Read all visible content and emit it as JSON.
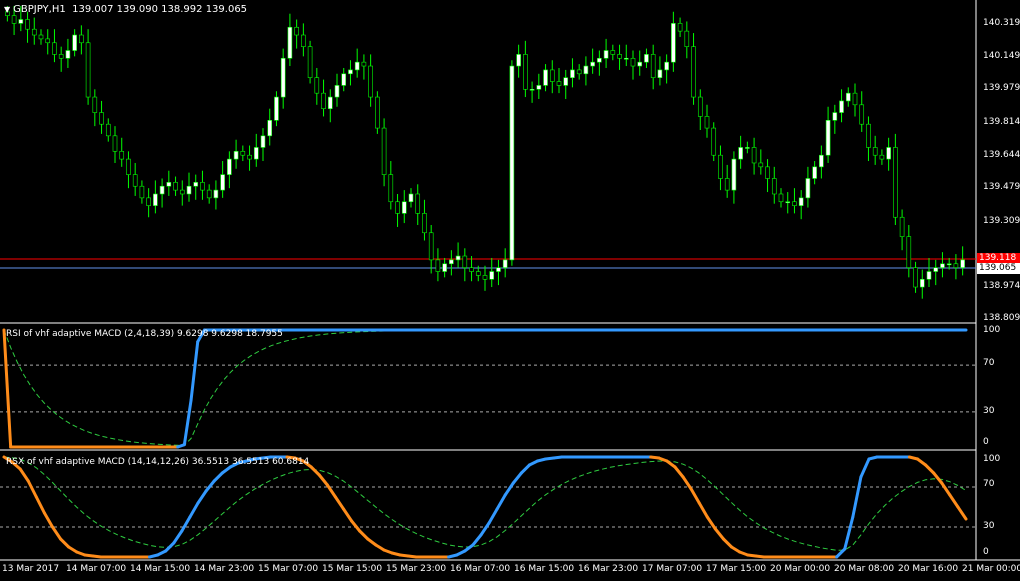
{
  "header": {
    "arrow_icon": "triangle-down-icon",
    "symbol": "GBPJPY,H1",
    "ohlc": "139.007 139.090 138.992 139.065"
  },
  "main_ticks": [
    "140.319",
    "140.149",
    "139.979",
    "139.814",
    "139.644",
    "139.479",
    "139.309",
    "138.974",
    "138.809"
  ],
  "current_price": "139.065",
  "red_level_price": "139.118",
  "colors": {
    "background": "#000000",
    "candle_up": "#ffffff",
    "candle_down": "#000000",
    "wick": "#00ff00",
    "red_line": "#ff0000",
    "blue_line": "#6495ed",
    "ind_up": "#3399ff",
    "ind_down": "#ff8c1a",
    "ind_signal": "#2ecc40"
  },
  "panel1": {
    "title": "RSI of vhf adaptive MACD (2,4,18,39) 9.6298 9.6298 18.7955",
    "ticks": [
      "100",
      "70",
      "30",
      "0"
    ]
  },
  "panel2": {
    "title": "RSX of vhf adaptive MACD (14,14,12,26) 36.5513 36.5513 60.6814",
    "ticks": [
      "100",
      "70",
      "30",
      "0"
    ]
  },
  "x_ticks": [
    "13 Mar 2017",
    "14 Mar 07:00",
    "14 Mar 15:00",
    "14 Mar 23:00",
    "15 Mar 07:00",
    "15 Mar 15:00",
    "15 Mar 23:00",
    "16 Mar 07:00",
    "16 Mar 15:00",
    "16 Mar 23:00",
    "17 Mar 07:00",
    "17 Mar 15:00",
    "20 Mar 00:00",
    "20 Mar 08:00",
    "20 Mar 16:00",
    "21 Mar 00:00"
  ],
  "chart_data": {
    "type": "candlestick",
    "ylim": [
      138.75,
      140.38
    ],
    "close": [
      140.32,
      140.28,
      140.3,
      140.25,
      140.22,
      140.2,
      140.18,
      140.12,
      140.1,
      140.14,
      140.22,
      140.18,
      139.9,
      139.82,
      139.76,
      139.7,
      139.62,
      139.58,
      139.5,
      139.44,
      139.38,
      139.34,
      139.4,
      139.44,
      139.46,
      139.42,
      139.4,
      139.44,
      139.46,
      139.42,
      139.38,
      139.42,
      139.5,
      139.58,
      139.62,
      139.6,
      139.58,
      139.64,
      139.7,
      139.78,
      139.9,
      140.1,
      140.26,
      140.22,
      140.16,
      140.0,
      139.92,
      139.84,
      139.9,
      139.96,
      140.02,
      140.04,
      140.08,
      140.06,
      139.9,
      139.74,
      139.5,
      139.36,
      139.3,
      139.36,
      139.4,
      139.3,
      139.2,
      139.06,
      139.0,
      139.04,
      139.06,
      139.08,
      139.02,
      139.0,
      138.98,
      138.96,
      139.0,
      139.02,
      139.06,
      140.06,
      140.12,
      139.94,
      139.94,
      139.96,
      140.04,
      139.98,
      139.96,
      140.0,
      140.04,
      140.02,
      140.06,
      140.08,
      140.1,
      140.14,
      140.12,
      140.1,
      140.1,
      140.06,
      140.08,
      140.12,
      140.0,
      140.04,
      140.08,
      140.28,
      140.24,
      140.16,
      139.9,
      139.8,
      139.74,
      139.6,
      139.48,
      139.42,
      139.58,
      139.64,
      139.64,
      139.56,
      139.54,
      139.48,
      139.4,
      139.36,
      139.36,
      139.34,
      139.38,
      139.48,
      139.54,
      139.6,
      139.78,
      139.82,
      139.88,
      139.92,
      139.86,
      139.76,
      139.64,
      139.6,
      139.58,
      139.64,
      139.28,
      139.18,
      139.02,
      138.92,
      138.96,
      139.0,
      139.02,
      139.04,
      139.04,
      139.02,
      139.06
    ],
    "rsi_main": [
      100,
      0,
      0,
      0,
      0,
      0,
      0,
      0,
      0,
      0,
      0,
      0,
      0,
      0,
      0,
      0,
      0,
      0,
      0,
      0,
      0,
      0,
      0,
      0,
      0,
      0,
      0,
      2,
      40,
      90,
      100,
      100,
      100,
      100,
      100,
      100,
      100,
      100,
      100,
      100,
      100,
      100,
      100,
      100,
      100,
      100,
      100,
      100,
      100,
      100,
      100,
      100,
      100,
      100,
      100,
      100,
      100,
      100,
      100,
      100,
      100,
      100,
      100,
      100,
      100,
      100,
      100,
      100,
      100,
      100,
      100,
      100,
      100,
      100,
      100,
      100,
      100,
      100,
      100,
      100,
      100,
      100,
      100,
      100,
      100,
      100,
      100,
      100,
      100,
      100,
      100,
      100,
      100,
      100,
      100,
      100,
      100,
      100,
      100,
      100,
      100,
      100,
      100,
      100,
      100,
      100,
      100,
      100,
      100,
      100,
      100,
      100,
      100,
      100,
      100,
      100,
      100,
      100,
      100,
      100,
      100,
      100,
      100,
      100,
      100,
      100,
      100,
      100,
      100,
      100,
      100,
      100,
      100,
      100,
      100,
      100,
      100,
      100,
      100,
      100,
      100,
      100,
      100,
      100,
      100
    ],
    "rsx_main": [
      100,
      95,
      88,
      76,
      60,
      44,
      30,
      18,
      10,
      5,
      2,
      1,
      0,
      0,
      0,
      0,
      0,
      0,
      0,
      2,
      6,
      14,
      26,
      40,
      54,
      66,
      76,
      84,
      90,
      94,
      96,
      98,
      99,
      100,
      100,
      100,
      99,
      96,
      90,
      82,
      72,
      60,
      48,
      36,
      26,
      18,
      12,
      7,
      4,
      2,
      1,
      0,
      0,
      0,
      0,
      0,
      2,
      6,
      12,
      22,
      34,
      48,
      62,
      74,
      84,
      92,
      96,
      98,
      99,
      100,
      100,
      100,
      100,
      100,
      100,
      100,
      100,
      100,
      100,
      100,
      100,
      99,
      96,
      90,
      80,
      68,
      54,
      40,
      28,
      18,
      10,
      5,
      2,
      1,
      0,
      0,
      0,
      0,
      0,
      0,
      0,
      0,
      0,
      0,
      8,
      40,
      80,
      98,
      100,
      100,
      100,
      100,
      100,
      98,
      92,
      84,
      74,
      62,
      50,
      38
    ]
  }
}
